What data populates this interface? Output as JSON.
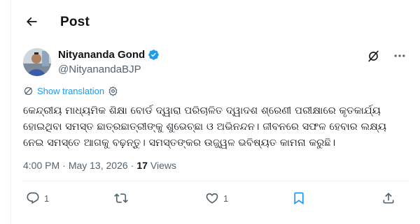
{
  "header": {
    "title": "Post",
    "back_icon": "arrow-left-icon"
  },
  "author": {
    "name": "Nityananda Gond",
    "handle": "@NityanandaBJP",
    "verified_icon": "verified-badge-icon",
    "verified_color": "#1d9bf0"
  },
  "header_actions": {
    "grok_icon": "grok-icon",
    "more_icon": "more-horizontal-icon"
  },
  "translation": {
    "label": "Show translation",
    "icon": "translate-icon",
    "settings_icon": "gear-icon"
  },
  "post": {
    "text": "କେନ୍ଦ୍ରୀୟ ମାଧ୍ୟମିକ ଶିକ୍ଷା ବୋର୍ଡ ଦ୍ୱାରା ପରିଚାଳିତ ଦ୍ୱାଦଶ ଶ୍ରେଣୀ ପରୀକ୍ଷାରେ କୃତକାର୍ଯ୍ୟ ହୋଇଥିବା ସମସ୍ତ ଛାତ୍ରଛାତ୍ରୀଙ୍କୁ ଶୁଭେଚ୍ଛା ଓ ଅଭିନନ୍ଦନ। ଜୀବନରେ ସଫଳ ହେବାର ଲକ୍ଷ୍ୟ ନେଇ ସମସ୍ତେ ଆଗକୁ ବଢ଼ନ୍ତୁ। ସମସ୍ତଙ୍କର ଉଜ୍ଜ୍ୱଳ ଭବିଷ୍ୟତ କାମନା କରୁଛି।"
  },
  "meta": {
    "time": "4:00 PM",
    "separator1": "·",
    "date": "May 13, 2026",
    "separator2": "·",
    "views_count": "17",
    "views_label": "Views"
  },
  "actions": {
    "reply": {
      "icon": "reply-icon",
      "count": "1"
    },
    "repost": {
      "icon": "repost-icon",
      "count": ""
    },
    "like": {
      "icon": "heart-icon",
      "count": "1"
    },
    "bookmark": {
      "icon": "bookmark-icon",
      "color": "#1d9bf0"
    },
    "share": {
      "icon": "share-icon"
    }
  },
  "colors": {
    "accent": "#1d9bf0",
    "secondary_text": "#536471",
    "primary_text": "#0f1419"
  }
}
